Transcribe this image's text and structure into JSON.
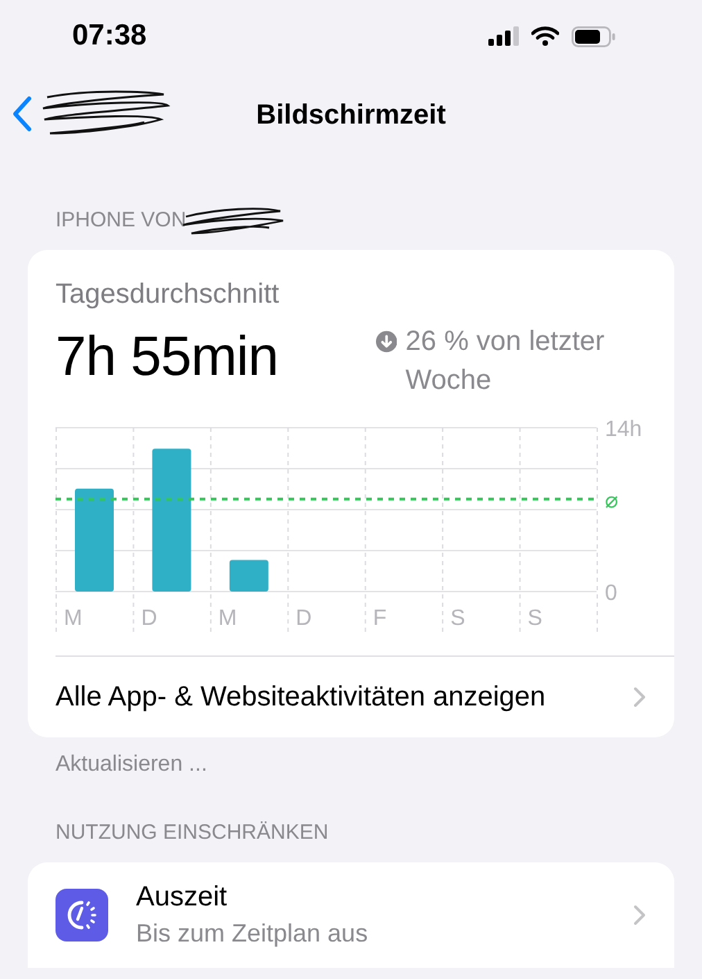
{
  "status_bar": {
    "time": "07:38"
  },
  "nav_bar": {
    "title": "Bildschirmzeit"
  },
  "device_section": {
    "header": "IPHONE VON"
  },
  "usage_card": {
    "label": "Tagesdurchschnitt",
    "value": "7h 55min",
    "decreased": true,
    "change": "26 % von letzter Woche",
    "chart_data": {
      "type": "bar",
      "categories": [
        "M",
        "D",
        "M",
        "D",
        "F",
        "S",
        "S"
      ],
      "values": [
        8.8,
        12.2,
        2.7,
        null,
        null,
        null,
        null
      ],
      "ylim": [
        0,
        14
      ],
      "yticks": [
        {
          "value": 0,
          "label": "0"
        },
        {
          "value": 14,
          "label": "14h"
        }
      ]
    },
    "average_symbol": "⌀",
    "link": "Alle App- & Websiteaktivitäten anzeigen"
  },
  "footer_note": "Aktualisieren ...",
  "limits_section": {
    "header": "NUTZUNG EINSCHRÄNKEN",
    "items": [
      {
        "title": "Auszeit",
        "subtitle": "Bis zum Zeitplan aus"
      }
    ]
  }
}
